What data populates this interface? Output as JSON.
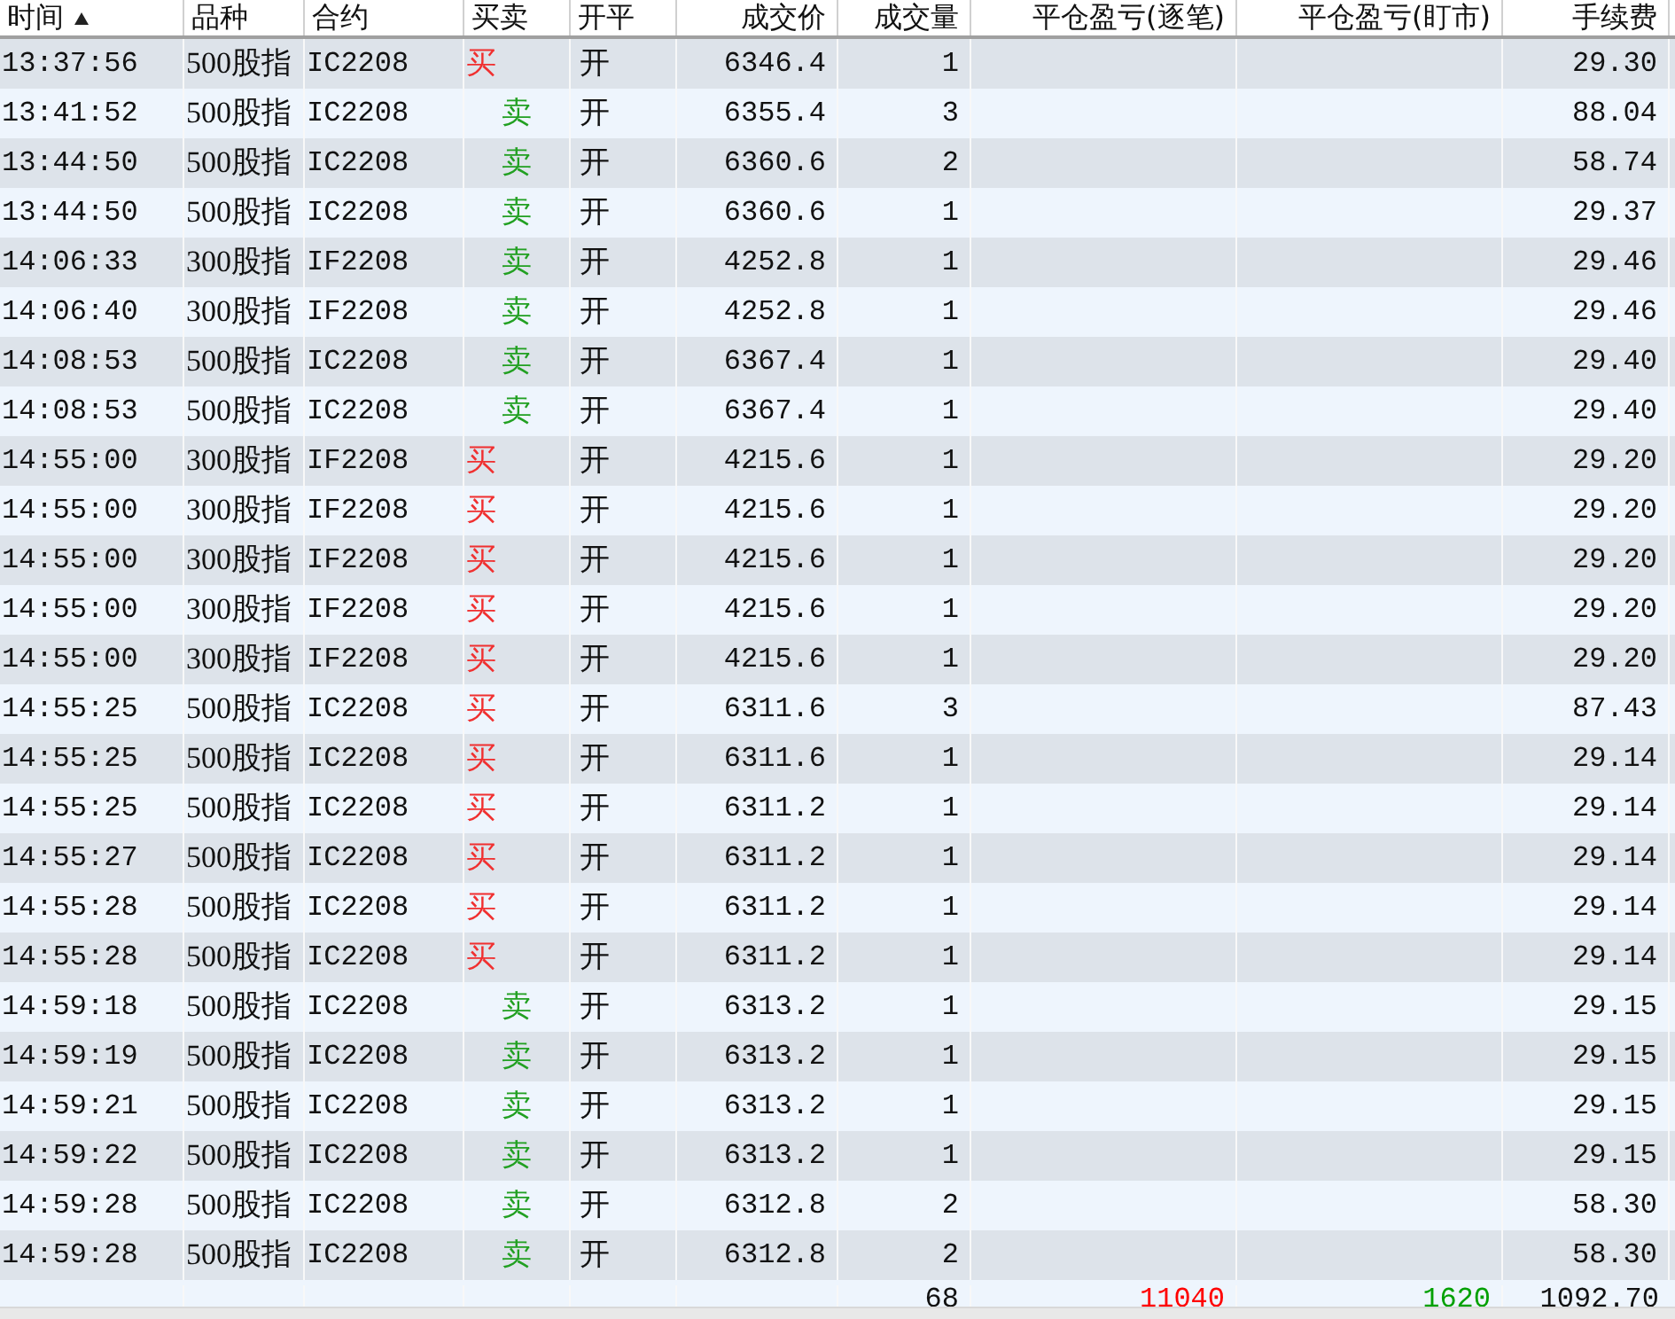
{
  "table": {
    "columns": [
      {
        "label": "时间",
        "sorted": true
      },
      {
        "label": "品种",
        "sorted": false
      },
      {
        "label": "合约",
        "sorted": false
      },
      {
        "label": "买卖",
        "sorted": false
      },
      {
        "label": "开平",
        "sorted": false
      },
      {
        "label": "成交价",
        "sorted": false
      },
      {
        "label": "成交量",
        "sorted": false
      },
      {
        "label": "平仓盈亏(逐笔)",
        "sorted": false
      },
      {
        "label": "平仓盈亏(盯市)",
        "sorted": false
      },
      {
        "label": "手续费",
        "sorted": false
      }
    ],
    "rows": [
      {
        "time": "13:37:56",
        "product": "500股指",
        "contract": "IC2208",
        "side": "买",
        "kind": "buy",
        "open_close": "开",
        "price": "6346.4",
        "volume": "1",
        "fee": "29.30"
      },
      {
        "time": "13:41:52",
        "product": "500股指",
        "contract": "IC2208",
        "side": "卖",
        "kind": "sell",
        "open_close": "开",
        "price": "6355.4",
        "volume": "3",
        "fee": "88.04"
      },
      {
        "time": "13:44:50",
        "product": "500股指",
        "contract": "IC2208",
        "side": "卖",
        "kind": "sell",
        "open_close": "开",
        "price": "6360.6",
        "volume": "2",
        "fee": "58.74"
      },
      {
        "time": "13:44:50",
        "product": "500股指",
        "contract": "IC2208",
        "side": "卖",
        "kind": "sell",
        "open_close": "开",
        "price": "6360.6",
        "volume": "1",
        "fee": "29.37"
      },
      {
        "time": "14:06:33",
        "product": "300股指",
        "contract": "IF2208",
        "side": "卖",
        "kind": "sell",
        "open_close": "开",
        "price": "4252.8",
        "volume": "1",
        "fee": "29.46"
      },
      {
        "time": "14:06:40",
        "product": "300股指",
        "contract": "IF2208",
        "side": "卖",
        "kind": "sell",
        "open_close": "开",
        "price": "4252.8",
        "volume": "1",
        "fee": "29.46"
      },
      {
        "time": "14:08:53",
        "product": "500股指",
        "contract": "IC2208",
        "side": "卖",
        "kind": "sell",
        "open_close": "开",
        "price": "6367.4",
        "volume": "1",
        "fee": "29.40"
      },
      {
        "time": "14:08:53",
        "product": "500股指",
        "contract": "IC2208",
        "side": "卖",
        "kind": "sell",
        "open_close": "开",
        "price": "6367.4",
        "volume": "1",
        "fee": "29.40"
      },
      {
        "time": "14:55:00",
        "product": "300股指",
        "contract": "IF2208",
        "side": "买",
        "kind": "buy",
        "open_close": "开",
        "price": "4215.6",
        "volume": "1",
        "fee": "29.20"
      },
      {
        "time": "14:55:00",
        "product": "300股指",
        "contract": "IF2208",
        "side": "买",
        "kind": "buy",
        "open_close": "开",
        "price": "4215.6",
        "volume": "1",
        "fee": "29.20"
      },
      {
        "time": "14:55:00",
        "product": "300股指",
        "contract": "IF2208",
        "side": "买",
        "kind": "buy",
        "open_close": "开",
        "price": "4215.6",
        "volume": "1",
        "fee": "29.20"
      },
      {
        "time": "14:55:00",
        "product": "300股指",
        "contract": "IF2208",
        "side": "买",
        "kind": "buy",
        "open_close": "开",
        "price": "4215.6",
        "volume": "1",
        "fee": "29.20"
      },
      {
        "time": "14:55:00",
        "product": "300股指",
        "contract": "IF2208",
        "side": "买",
        "kind": "buy",
        "open_close": "开",
        "price": "4215.6",
        "volume": "1",
        "fee": "29.20"
      },
      {
        "time": "14:55:25",
        "product": "500股指",
        "contract": "IC2208",
        "side": "买",
        "kind": "buy",
        "open_close": "开",
        "price": "6311.6",
        "volume": "3",
        "fee": "87.43"
      },
      {
        "time": "14:55:25",
        "product": "500股指",
        "contract": "IC2208",
        "side": "买",
        "kind": "buy",
        "open_close": "开",
        "price": "6311.6",
        "volume": "1",
        "fee": "29.14"
      },
      {
        "time": "14:55:25",
        "product": "500股指",
        "contract": "IC2208",
        "side": "买",
        "kind": "buy",
        "open_close": "开",
        "price": "6311.2",
        "volume": "1",
        "fee": "29.14"
      },
      {
        "time": "14:55:27",
        "product": "500股指",
        "contract": "IC2208",
        "side": "买",
        "kind": "buy",
        "open_close": "开",
        "price": "6311.2",
        "volume": "1",
        "fee": "29.14"
      },
      {
        "time": "14:55:28",
        "product": "500股指",
        "contract": "IC2208",
        "side": "买",
        "kind": "buy",
        "open_close": "开",
        "price": "6311.2",
        "volume": "1",
        "fee": "29.14"
      },
      {
        "time": "14:55:28",
        "product": "500股指",
        "contract": "IC2208",
        "side": "买",
        "kind": "buy",
        "open_close": "开",
        "price": "6311.2",
        "volume": "1",
        "fee": "29.14"
      },
      {
        "time": "14:59:18",
        "product": "500股指",
        "contract": "IC2208",
        "side": "卖",
        "kind": "sell",
        "open_close": "开",
        "price": "6313.2",
        "volume": "1",
        "fee": "29.15"
      },
      {
        "time": "14:59:19",
        "product": "500股指",
        "contract": "IC2208",
        "side": "卖",
        "kind": "sell",
        "open_close": "开",
        "price": "6313.2",
        "volume": "1",
        "fee": "29.15"
      },
      {
        "time": "14:59:21",
        "product": "500股指",
        "contract": "IC2208",
        "side": "卖",
        "kind": "sell",
        "open_close": "开",
        "price": "6313.2",
        "volume": "1",
        "fee": "29.15"
      },
      {
        "time": "14:59:22",
        "product": "500股指",
        "contract": "IC2208",
        "side": "卖",
        "kind": "sell",
        "open_close": "开",
        "price": "6313.2",
        "volume": "1",
        "fee": "29.15"
      },
      {
        "time": "14:59:28",
        "product": "500股指",
        "contract": "IC2208",
        "side": "卖",
        "kind": "sell",
        "open_close": "开",
        "price": "6312.8",
        "volume": "2",
        "fee": "58.30"
      },
      {
        "time": "14:59:28",
        "product": "500股指",
        "contract": "IC2208",
        "side": "卖",
        "kind": "sell",
        "open_close": "开",
        "price": "6312.8",
        "volume": "2",
        "fee": "58.30"
      }
    ],
    "totals": {
      "volume": "68",
      "pnl_by_trade": {
        "text": "11040",
        "color": "#ff0000"
      },
      "pnl_mark_to_market": {
        "text": "1620",
        "color": "#00a000"
      },
      "fee": "1092.70"
    }
  }
}
